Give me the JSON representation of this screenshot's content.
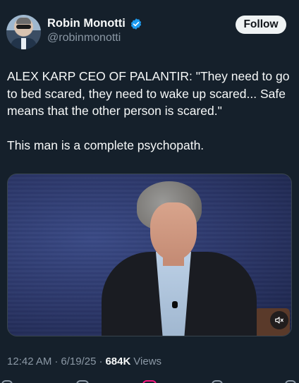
{
  "header": {
    "display_name": "Robin Monotti",
    "handle": "@robinmonotti",
    "follow_label": "Follow"
  },
  "tweet": {
    "lines": [
      "ALEX KARP CEO OF PALANTIR: \"They need to go to bed scared, they need to wake up scared... Safe means that the other person is scared.\"",
      "This man is a complete psychopath."
    ]
  },
  "meta": {
    "time": "12:42 AM",
    "separator1": "·",
    "date": "6/19/25",
    "separator2": "·",
    "views_count": "684K",
    "views_label": "Views"
  },
  "colors": {
    "background": "#15202b",
    "text": "#f7f9f9",
    "secondary": "#8b98a5",
    "verified": "#1d9bf0",
    "follow_bg": "#eff3f4"
  }
}
